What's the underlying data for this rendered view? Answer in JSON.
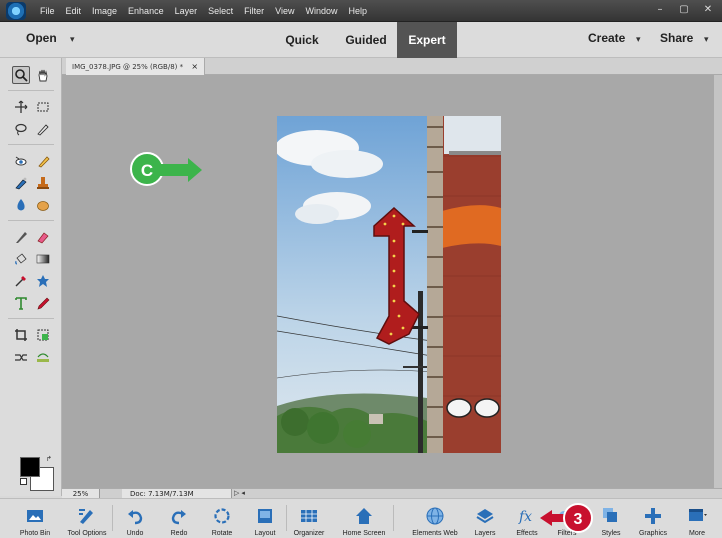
{
  "menubar": {
    "items": [
      "File",
      "Edit",
      "Image",
      "Enhance",
      "Layer",
      "Select",
      "Filter",
      "View",
      "Window",
      "Help"
    ],
    "minimize": "–",
    "restore": "▢",
    "close": "✕"
  },
  "modebar": {
    "open_label": "Open",
    "tabs": [
      {
        "label": "Quick"
      },
      {
        "label": "Guided"
      },
      {
        "label": "Expert"
      }
    ],
    "create_label": "Create",
    "share_label": "Share"
  },
  "document": {
    "tab_title": "IMG_0378.JPG @ 25% (RGB/8) *",
    "close_glyph": "×"
  },
  "status": {
    "zoom": "25%",
    "doc_size": "Doc: 7.13M/7.13M",
    "arrow": "▷ ◂"
  },
  "callouts": {
    "c": "C",
    "three": "3"
  },
  "taskbar": {
    "items": [
      {
        "label": "Photo Bin"
      },
      {
        "label": "Tool Options"
      },
      {
        "label": "Undo"
      },
      {
        "label": "Redo"
      },
      {
        "label": "Rotate"
      },
      {
        "label": "Layout"
      },
      {
        "label": "Organizer"
      },
      {
        "label": "Home Screen"
      },
      {
        "label": "Elements Web"
      },
      {
        "label": "Layers"
      },
      {
        "label": "Effects"
      },
      {
        "label": "Filters"
      },
      {
        "label": "Styles"
      },
      {
        "label": "Graphics"
      },
      {
        "label": "More"
      }
    ]
  },
  "colors": {
    "accent_tab": "#545454",
    "callout_green": "#3cb44b",
    "callout_red": "#c8102e",
    "icon_blue": "#2a6fb8"
  }
}
